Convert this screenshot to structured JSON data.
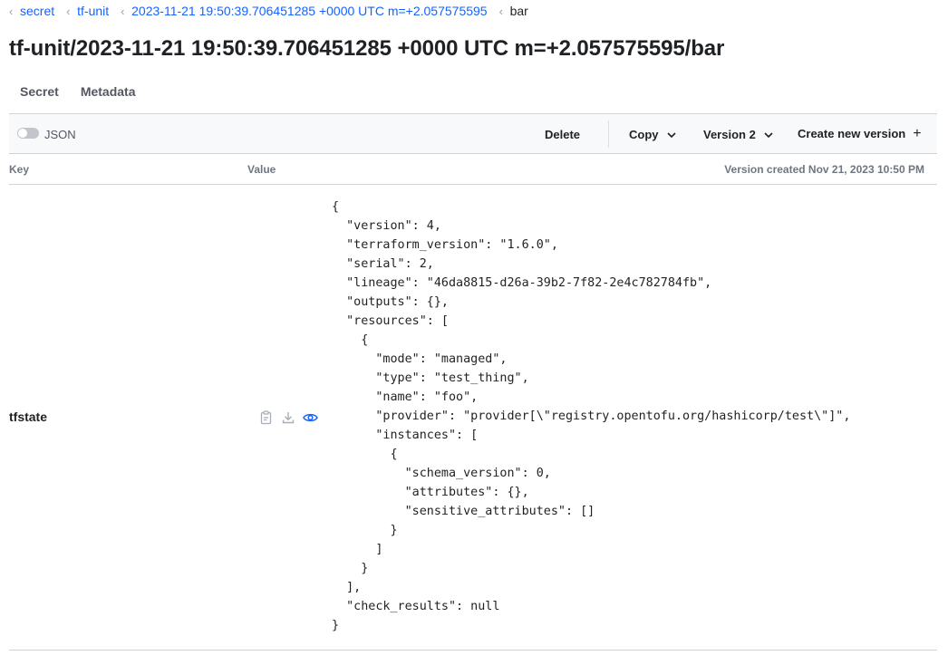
{
  "breadcrumb": [
    {
      "label": "secret",
      "link": true
    },
    {
      "label": "tf-unit",
      "link": true
    },
    {
      "label": "2023-11-21 19:50:39.706451285 +0000 UTC m=+2.057575595",
      "link": true
    },
    {
      "label": "bar",
      "link": false
    }
  ],
  "title": "tf-unit/2023-11-21 19:50:39.706451285 +0000 UTC m=+2.057575595/bar",
  "tabs": {
    "secret": "Secret",
    "metadata": "Metadata"
  },
  "toolbar": {
    "json_toggle_label": "JSON",
    "json_toggle_on": false,
    "delete_label": "Delete",
    "copy_label": "Copy",
    "version_label": "Version 2",
    "create_label": "Create new version"
  },
  "table": {
    "key_header": "Key",
    "value_header": "Value",
    "version_created": "Version created Nov 21, 2023 10:50 PM"
  },
  "row": {
    "key": "tfstate",
    "icons": [
      "copy-icon",
      "download-icon",
      "eye-icon"
    ],
    "value": "{\n  \"version\": 4,\n  \"terraform_version\": \"1.6.0\",\n  \"serial\": 2,\n  \"lineage\": \"46da8815-d26a-39b2-7f82-2e4c782784fb\",\n  \"outputs\": {},\n  \"resources\": [\n    {\n      \"mode\": \"managed\",\n      \"type\": \"test_thing\",\n      \"name\": \"foo\",\n      \"provider\": \"provider[\\\"registry.opentofu.org/hashicorp/test\\\"]\",\n      \"instances\": [\n        {\n          \"schema_version\": 0,\n          \"attributes\": {},\n          \"sensitive_attributes\": []\n        }\n      ]\n    }\n  ],\n  \"check_results\": null\n}"
  },
  "colors": {
    "link": "#1563ff",
    "eye_icon": "#1563ff",
    "muted_icon": "#a8aeb7"
  }
}
